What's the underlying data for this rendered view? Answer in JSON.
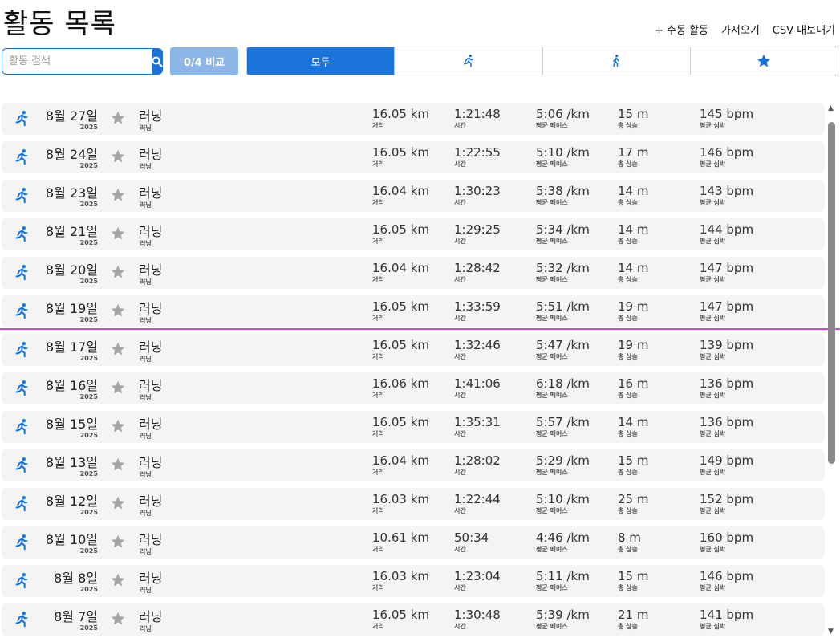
{
  "header": {
    "title": "활동 목록",
    "actions": [
      "+ 수동 활동",
      "가져오기",
      "CSV 내보내기"
    ]
  },
  "search": {
    "placeholder": "활동 검색",
    "value": ""
  },
  "compare": {
    "label": "0/4 비교"
  },
  "filters": [
    {
      "label": "모두",
      "icon": "",
      "active": true
    },
    {
      "label": "",
      "icon": "running-icon",
      "active": false
    },
    {
      "label": "",
      "icon": "walking-icon",
      "active": false
    },
    {
      "label": "",
      "icon": "star-icon",
      "active": false
    }
  ],
  "colors": {
    "accent": "#1a73d9",
    "compare": "#8db6e8",
    "star": "#a6a6a6",
    "divider": "#e040e0"
  },
  "labels": {
    "distance": "거리",
    "time": "시간",
    "pace": "평균 페이스",
    "elevation": "총 상승",
    "hr": "평균 심박"
  },
  "activities": [
    {
      "date": "8월 27일",
      "year": "2025",
      "name": "러닝",
      "sub": "러닝",
      "distance": "16.05 km",
      "time": "1:21:48",
      "pace": "5:06 /km",
      "elevation": "15 m",
      "hr": "145 bpm"
    },
    {
      "date": "8월 24일",
      "year": "2025",
      "name": "러닝",
      "sub": "러닝",
      "distance": "16.05 km",
      "time": "1:22:55",
      "pace": "5:10 /km",
      "elevation": "17 m",
      "hr": "146 bpm"
    },
    {
      "date": "8월 23일",
      "year": "2025",
      "name": "러닝",
      "sub": "러닝",
      "distance": "16.04 km",
      "time": "1:30:23",
      "pace": "5:38 /km",
      "elevation": "14 m",
      "hr": "143 bpm"
    },
    {
      "date": "8월 21일",
      "year": "2025",
      "name": "러닝",
      "sub": "러닝",
      "distance": "16.05 km",
      "time": "1:29:25",
      "pace": "5:34 /km",
      "elevation": "14 m",
      "hr": "144 bpm"
    },
    {
      "date": "8월 20일",
      "year": "2025",
      "name": "러닝",
      "sub": "러닝",
      "distance": "16.04 km",
      "time": "1:28:42",
      "pace": "5:32 /km",
      "elevation": "14 m",
      "hr": "147 bpm"
    },
    {
      "date": "8월 19일",
      "year": "2025",
      "name": "러닝",
      "sub": "러닝",
      "distance": "16.05 km",
      "time": "1:33:59",
      "pace": "5:51 /km",
      "elevation": "19 m",
      "hr": "147 bpm"
    },
    {
      "date": "8월 17일",
      "year": "2025",
      "name": "러닝",
      "sub": "러닝",
      "distance": "16.05 km",
      "time": "1:32:46",
      "pace": "5:47 /km",
      "elevation": "19 m",
      "hr": "139 bpm"
    },
    {
      "date": "8월 16일",
      "year": "2025",
      "name": "러닝",
      "sub": "러닝",
      "distance": "16.06 km",
      "time": "1:41:06",
      "pace": "6:18 /km",
      "elevation": "16 m",
      "hr": "136 bpm"
    },
    {
      "date": "8월 15일",
      "year": "2025",
      "name": "러닝",
      "sub": "러닝",
      "distance": "16.05 km",
      "time": "1:35:31",
      "pace": "5:57 /km",
      "elevation": "14 m",
      "hr": "136 bpm"
    },
    {
      "date": "8월 13일",
      "year": "2025",
      "name": "러닝",
      "sub": "러닝",
      "distance": "16.04 km",
      "time": "1:28:02",
      "pace": "5:29 /km",
      "elevation": "15 m",
      "hr": "149 bpm"
    },
    {
      "date": "8월 12일",
      "year": "2025",
      "name": "러닝",
      "sub": "러닝",
      "distance": "16.03 km",
      "time": "1:22:44",
      "pace": "5:10 /km",
      "elevation": "25 m",
      "hr": "152 bpm"
    },
    {
      "date": "8월 10일",
      "year": "2025",
      "name": "러닝",
      "sub": "러닝",
      "distance": "10.61 km",
      "time": "50:34",
      "pace": "4:46 /km",
      "elevation": "8 m",
      "hr": "160 bpm"
    },
    {
      "date": "8월 8일",
      "year": "2025",
      "name": "러닝",
      "sub": "러닝",
      "distance": "16.03 km",
      "time": "1:23:04",
      "pace": "5:11 /km",
      "elevation": "15 m",
      "hr": "146 bpm"
    },
    {
      "date": "8월 7일",
      "year": "2025",
      "name": "러닝",
      "sub": "러닝",
      "distance": "16.05 km",
      "time": "1:30:48",
      "pace": "5:39 /km",
      "elevation": "21 m",
      "hr": "141 bpm"
    }
  ]
}
